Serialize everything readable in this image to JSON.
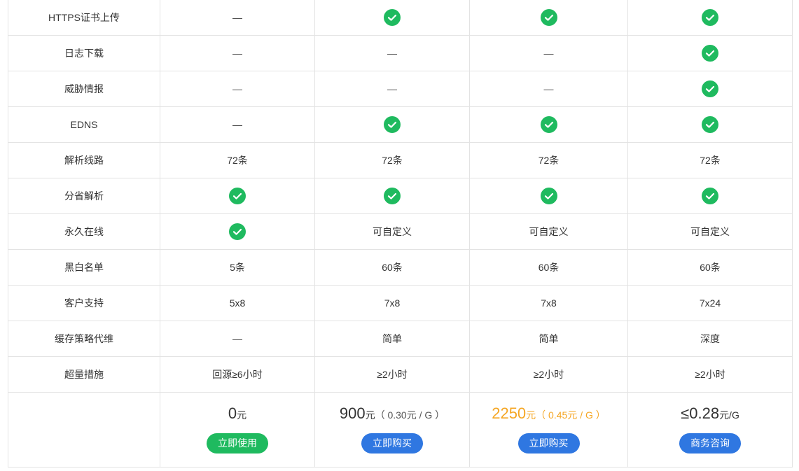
{
  "rows": [
    {
      "feature": "HTTPS证书上传",
      "cells": [
        {
          "type": "dash",
          "text": "—"
        },
        {
          "type": "check"
        },
        {
          "type": "check"
        },
        {
          "type": "check"
        }
      ]
    },
    {
      "feature": "日志下载",
      "cells": [
        {
          "type": "dash",
          "text": "—"
        },
        {
          "type": "dash",
          "text": "—"
        },
        {
          "type": "dash",
          "text": "—"
        },
        {
          "type": "check"
        }
      ]
    },
    {
      "feature": "威胁情报",
      "cells": [
        {
          "type": "dash",
          "text": "—"
        },
        {
          "type": "dash",
          "text": "—"
        },
        {
          "type": "dash",
          "text": "—"
        },
        {
          "type": "check"
        }
      ]
    },
    {
      "feature": "EDNS",
      "cells": [
        {
          "type": "dash",
          "text": "—"
        },
        {
          "type": "check"
        },
        {
          "type": "check"
        },
        {
          "type": "check"
        }
      ]
    },
    {
      "feature": "解析线路",
      "cells": [
        {
          "type": "text",
          "text": "72条"
        },
        {
          "type": "text",
          "text": "72条"
        },
        {
          "type": "text",
          "text": "72条"
        },
        {
          "type": "text",
          "text": "72条"
        }
      ]
    },
    {
      "feature": "分省解析",
      "cells": [
        {
          "type": "check"
        },
        {
          "type": "check"
        },
        {
          "type": "check"
        },
        {
          "type": "check"
        }
      ]
    },
    {
      "feature": "永久在线",
      "cells": [
        {
          "type": "check"
        },
        {
          "type": "text",
          "text": "可自定义"
        },
        {
          "type": "text",
          "text": "可自定义"
        },
        {
          "type": "text",
          "text": "可自定义"
        }
      ]
    },
    {
      "feature": "黑白名单",
      "cells": [
        {
          "type": "text",
          "text": "5条"
        },
        {
          "type": "text",
          "text": "60条"
        },
        {
          "type": "text",
          "text": "60条"
        },
        {
          "type": "text",
          "text": "60条"
        }
      ]
    },
    {
      "feature": "客户支持",
      "cells": [
        {
          "type": "text",
          "text": "5x8"
        },
        {
          "type": "text",
          "text": "7x8"
        },
        {
          "type": "text",
          "text": "7x8"
        },
        {
          "type": "text",
          "text": "7x24"
        }
      ]
    },
    {
      "feature": "缓存策略代维",
      "cells": [
        {
          "type": "dash",
          "text": "—"
        },
        {
          "type": "text",
          "text": "简单"
        },
        {
          "type": "text",
          "text": "简单"
        },
        {
          "type": "text",
          "text": "深度"
        }
      ]
    },
    {
      "feature": "超量措施",
      "cells": [
        {
          "type": "text",
          "text": "回源≥6小时"
        },
        {
          "type": "text",
          "text": "≥2小时"
        },
        {
          "type": "text",
          "text": "≥2小时"
        },
        {
          "type": "text",
          "text": "≥2小时"
        }
      ]
    }
  ],
  "prices": [
    {
      "amount": "0",
      "unit": "元",
      "note": "",
      "highlight": false,
      "button": "立即使用",
      "button_style": "green"
    },
    {
      "amount": "900",
      "unit": "元",
      "note": "（ 0.30元 / G ）",
      "highlight": false,
      "button": "立即购买",
      "button_style": "blue"
    },
    {
      "amount": "2250",
      "unit": "元",
      "note": "（ 0.45元 / G ）",
      "highlight": true,
      "button": "立即购买",
      "button_style": "blue"
    },
    {
      "amount": "≤0.28",
      "unit": "元/G",
      "note": "",
      "highlight": false,
      "button": "商务咨询",
      "button_style": "blue"
    }
  ],
  "colors": {
    "check": "#1fba5f",
    "button_green": "#1fba5f",
    "button_blue": "#2f77e1",
    "highlight_price": "#f5a623",
    "border": "#e3e3e3"
  },
  "icons": {
    "check": "check-circle-icon"
  }
}
